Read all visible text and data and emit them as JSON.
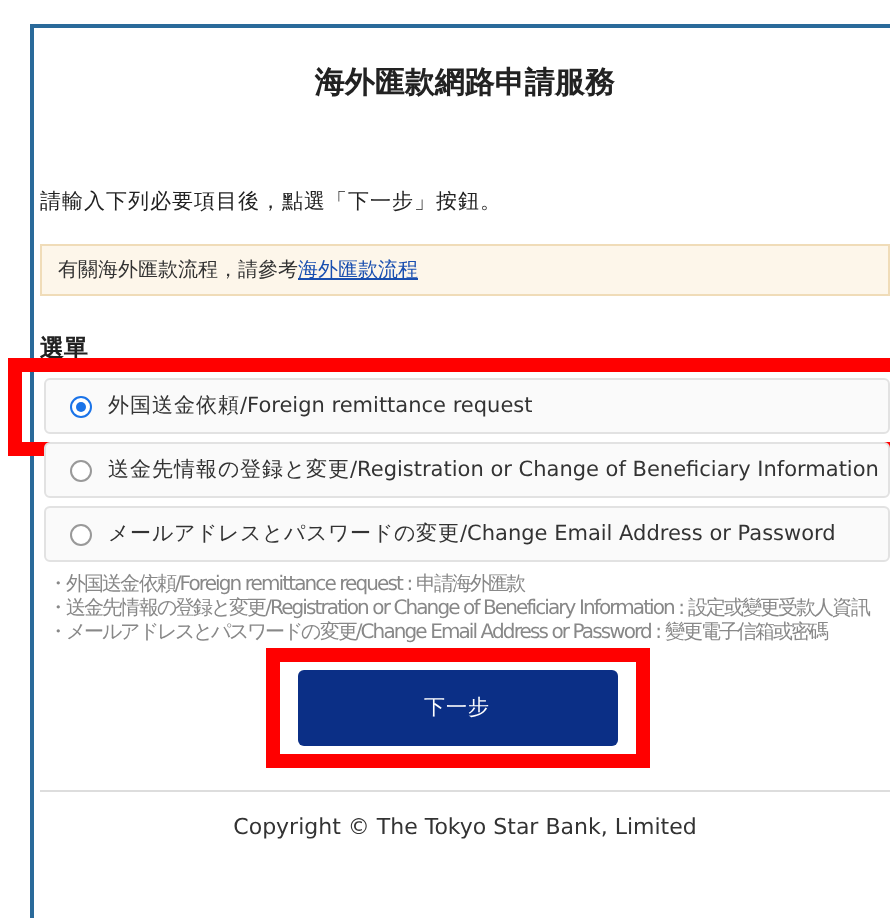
{
  "title": "海外匯款網路申請服務",
  "instruction": "請輸入下列必要項目後，點選「下一步」按鈕。",
  "notice": {
    "text": "有關海外匯款流程，請參考",
    "link": "海外匯款流程"
  },
  "menu": {
    "heading": "選單",
    "options": [
      {
        "label": "外国送金依頼/Foreign remittance request",
        "selected": true,
        "highlighted": true
      },
      {
        "label": "送金先情報の登録と変更/Registration or Change of Beneficiary Information",
        "selected": false,
        "highlighted": false
      },
      {
        "label": "メールアドレスとパスワードの変更/Change Email Address or Password",
        "selected": false,
        "highlighted": false
      }
    ]
  },
  "notes": [
    "・外国送金依頼/Foreign remittance request : 申請海外匯款",
    "・送金先情報の登録と変更/Registration or Change of Beneficiary Information : 設定或變更受款人資訊",
    "・メールアドレスとパスワードの変更/Change Email Address or Password : 變更電子信箱或密碼"
  ],
  "next_button": {
    "label": "下一步",
    "highlighted": true
  },
  "footer": "Copyright © The Tokyo Star Bank, Limited"
}
